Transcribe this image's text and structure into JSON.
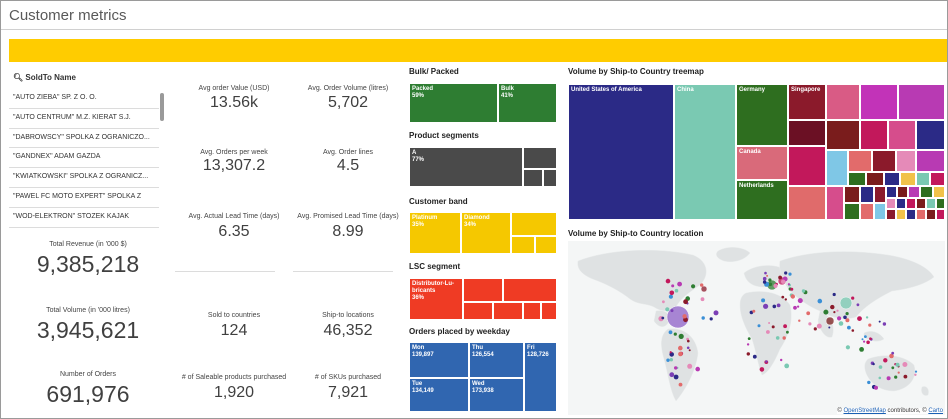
{
  "app": {
    "title": "Customer metrics"
  },
  "colors": {
    "banner": "#ffcc00",
    "green": "#2e7d32",
    "gray": "#4a4a4a",
    "yellow": "#f5c800",
    "red": "#ef3b24",
    "blue": "#3066b0",
    "navy": "#2b2a86",
    "teal": "#7ac9b2"
  },
  "search": {
    "label": "SoldTo Name",
    "icon": "search-icon",
    "items": [
      "\"AUTO ZIEBA\" SP. Z O. O.",
      "\"AUTO CENTRUM\" M.Z. KIERAT S.J.",
      "\"DABROWSCY\" SPOLKA Z OGRANICZO...",
      "\"GANDNEX\" ADAM GAZDA",
      "\"KWIATKOWSKI\" SPOLKA Z OGRANICZ...",
      "\"PAWEL FC MOTO EXPERT\" SPOLKA Z",
      "\"WOD-ELEKTRON\" STOZEK KAJAK"
    ]
  },
  "kpis_left": [
    {
      "label": "Total Revenue (in '000 $)",
      "value": "9,385,218"
    },
    {
      "label": "Total Volume (in '000 litres)",
      "value": "3,945,621"
    },
    {
      "label": "Number of Orders",
      "value": "691,976"
    }
  ],
  "kpis_grid": [
    {
      "label": "Avg order Value (USD)",
      "value": "13.56k"
    },
    {
      "label": "Avg. Order Volume (litres)",
      "value": "5,702"
    },
    {
      "label": "Avg. Orders per week",
      "value": "13,307.2"
    },
    {
      "label": "Avg. Order lines",
      "value": "4.5"
    },
    {
      "label": "Avg. Actual Lead Time (days)",
      "value": "6.35"
    },
    {
      "label": "Avg. Promised Lead Time (days)",
      "value": "8.99"
    },
    {
      "label": "Sold to countries",
      "value": "124"
    },
    {
      "label": "Ship-to locations",
      "value": "46,352"
    },
    {
      "label": "# of Saleable products purchased",
      "value": "1,920"
    },
    {
      "label": "# of SKUs purchased",
      "value": "7,921"
    }
  ],
  "bulk_packed": {
    "title": "Bulk/ Packed",
    "cells": [
      {
        "name": "Packed",
        "pct": "59%",
        "share": 0.59
      },
      {
        "name": "Bulk",
        "pct": "41%",
        "share": 0.41
      }
    ]
  },
  "product_segments": {
    "title": "Product segments",
    "cells": [
      {
        "name": "A",
        "pct": "77%"
      }
    ]
  },
  "customer_band": {
    "title": "Customer band",
    "cells": [
      {
        "name": "Platinum",
        "pct": "35%"
      },
      {
        "name": "Diamond",
        "pct": "34%"
      }
    ]
  },
  "lsc_segment": {
    "title": "LSC segment",
    "cells": [
      {
        "name": "Distributor-Lu-bricants",
        "pct": "36%"
      }
    ]
  },
  "weekday": {
    "title": "Orders placed by weekday",
    "cells": [
      {
        "day": "Mon",
        "value": "139,897"
      },
      {
        "day": "Thu",
        "value": "126,554"
      },
      {
        "day": "Fri",
        "value": "128,726"
      },
      {
        "day": "Tue",
        "value": "134,149"
      },
      {
        "day": "Wed",
        "value": "173,938"
      }
    ]
  },
  "treemap": {
    "title": "Volume by Ship-to Country treemap",
    "labels": [
      "United States of America",
      "China",
      "Germany",
      "Singapore",
      "Canada",
      "Netherlands"
    ]
  },
  "map": {
    "title": "Volume by Ship-to Country location",
    "credit_link1": "OpenStreetMap",
    "credit_text": "contributors, ©",
    "credit_link2": "Carto"
  }
}
